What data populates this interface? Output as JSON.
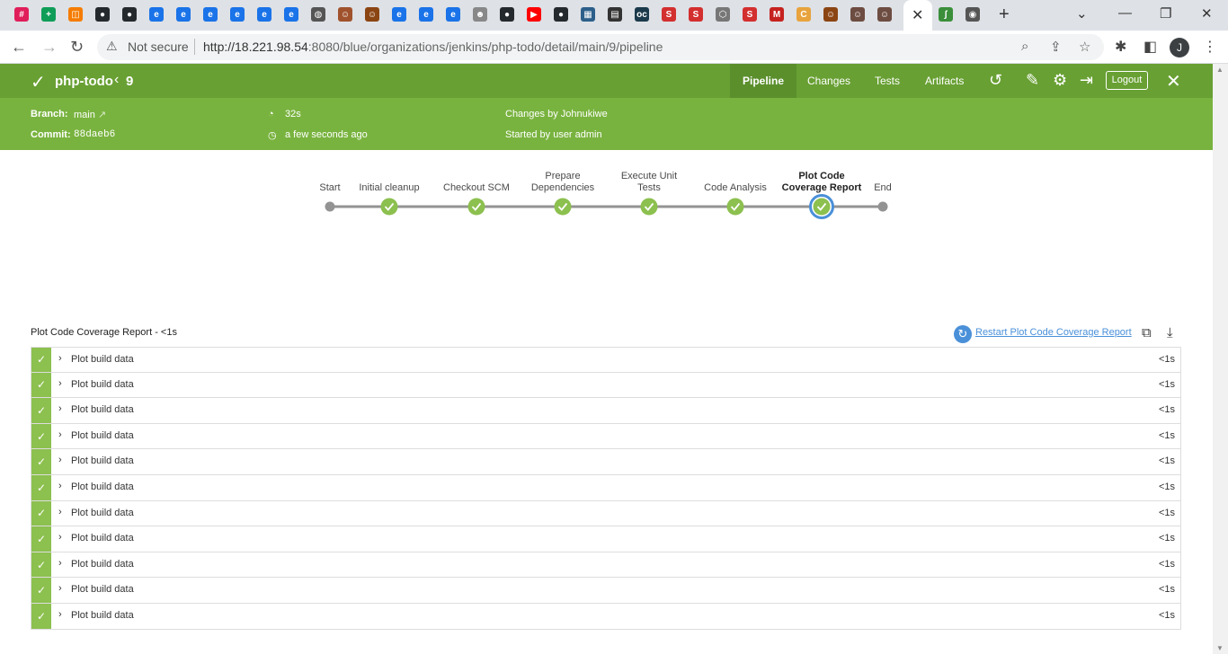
{
  "browser": {
    "tab_icons": [
      {
        "icon": "slack-icon",
        "glyph": "#",
        "color": "#e01e5a"
      },
      {
        "icon": "sheets-icon",
        "glyph": "+",
        "color": "#0f9d58"
      },
      {
        "icon": "app-icon",
        "glyph": "◫",
        "color": "#f57c00"
      },
      {
        "icon": "github-icon",
        "glyph": "●",
        "color": "#24292e"
      },
      {
        "icon": "github-icon",
        "glyph": "●",
        "color": "#24292e"
      },
      {
        "icon": "blue-app-icon",
        "glyph": "e",
        "color": "#1a73e8"
      },
      {
        "icon": "blue-app-icon",
        "glyph": "e",
        "color": "#1a73e8"
      },
      {
        "icon": "blue-app-icon",
        "glyph": "e",
        "color": "#1a73e8"
      },
      {
        "icon": "blue-app-icon",
        "glyph": "e",
        "color": "#1a73e8"
      },
      {
        "icon": "blue-app-icon",
        "glyph": "e",
        "color": "#1a73e8"
      },
      {
        "icon": "blue-app-icon",
        "glyph": "e",
        "color": "#1a73e8"
      },
      {
        "icon": "globe-icon",
        "glyph": "◍",
        "color": "#555555"
      },
      {
        "icon": "avatar-tab-icon",
        "glyph": "☺",
        "color": "#a0522d"
      },
      {
        "icon": "avatar-tab-icon",
        "glyph": "☺",
        "color": "#8b4513"
      },
      {
        "icon": "blue-app-icon",
        "glyph": "e",
        "color": "#1a73e8"
      },
      {
        "icon": "blue-app-icon",
        "glyph": "e",
        "color": "#1a73e8"
      },
      {
        "icon": "blue-app-icon",
        "glyph": "e",
        "color": "#1a73e8"
      },
      {
        "icon": "jenkins-icon",
        "glyph": "☻",
        "color": "#888888"
      },
      {
        "icon": "github-icon",
        "glyph": "●",
        "color": "#24292e"
      },
      {
        "icon": "youtube-icon",
        "glyph": "▶",
        "color": "#ff0000"
      },
      {
        "icon": "github-icon",
        "glyph": "●",
        "color": "#24292e"
      },
      {
        "icon": "grid-icon",
        "glyph": "▦",
        "color": "#2c5f8a"
      },
      {
        "icon": "bbc-icon",
        "glyph": "▤",
        "color": "#333333"
      },
      {
        "icon": "oc-icon",
        "glyph": "oc",
        "color": "#1b3a4b"
      },
      {
        "icon": "s-app-icon",
        "glyph": "S",
        "color": "#d32f2f"
      },
      {
        "icon": "s-app-icon",
        "glyph": "S",
        "color": "#d32f2f"
      },
      {
        "icon": "hex-icon",
        "glyph": "⬡",
        "color": "#777777"
      },
      {
        "icon": "s-app-icon",
        "glyph": "S",
        "color": "#d32f2f"
      },
      {
        "icon": "gmail-icon",
        "glyph": "M",
        "color": "#c5221f"
      },
      {
        "icon": "c-app-icon",
        "glyph": "C",
        "color": "#e8a33d"
      },
      {
        "icon": "avatar-tab-icon",
        "glyph": "☺",
        "color": "#8b4513"
      },
      {
        "icon": "avatar-tab-icon",
        "glyph": "☺",
        "color": "#6d4c41"
      },
      {
        "icon": "avatar-tab-icon",
        "glyph": "☺",
        "color": "#6d4c41"
      }
    ],
    "tab_icons_after_active": [
      {
        "icon": "snake-icon",
        "glyph": "ʃ",
        "color": "#3b8f3b"
      },
      {
        "icon": "chrome-icon",
        "glyph": "◉",
        "color": "#555555"
      }
    ],
    "not_secure_label": "Not secure",
    "url_host": "http://18.221.98.54",
    "url_rest": ":8080/blue/organizations/jenkins/php-todo/detail/main/9/pipeline",
    "profile_initial": "J"
  },
  "header": {
    "job_name": "php-todo",
    "run_number": "9",
    "tabs": [
      "Pipeline",
      "Changes",
      "Tests",
      "Artifacts"
    ],
    "logout_label": "Logout"
  },
  "summary": {
    "branch_label": "Branch:",
    "branch_value": "main",
    "commit_label": "Commit:",
    "commit_value": "88daeb6",
    "duration": "32s",
    "finished": "a few seconds ago",
    "changes_by": "Changes by Johnukiwe",
    "started_by": "Started by user admin"
  },
  "pipeline": {
    "stages": [
      {
        "label": [
          "Start"
        ],
        "status": "start"
      },
      {
        "label": [
          "Initial cleanup"
        ],
        "status": "success"
      },
      {
        "label": [
          "Checkout SCM"
        ],
        "status": "success"
      },
      {
        "label": [
          "Prepare",
          "Dependencies"
        ],
        "status": "success"
      },
      {
        "label": [
          "Execute Unit",
          "Tests"
        ],
        "status": "success"
      },
      {
        "label": [
          "Code Analysis"
        ],
        "status": "success"
      },
      {
        "label": [
          "Plot Code",
          "Coverage Report"
        ],
        "status": "success",
        "selected": true
      },
      {
        "label": [
          "End"
        ],
        "status": "end"
      }
    ]
  },
  "log": {
    "title": "Plot Code Coverage Report - <1s",
    "restart_label": "Restart Plot Code Coverage Report",
    "steps": [
      {
        "name": "Plot build data",
        "duration": "<1s"
      },
      {
        "name": "Plot build data",
        "duration": "<1s"
      },
      {
        "name": "Plot build data",
        "duration": "<1s"
      },
      {
        "name": "Plot build data",
        "duration": "<1s"
      },
      {
        "name": "Plot build data",
        "duration": "<1s"
      },
      {
        "name": "Plot build data",
        "duration": "<1s"
      },
      {
        "name": "Plot build data",
        "duration": "<1s"
      },
      {
        "name": "Plot build data",
        "duration": "<1s"
      },
      {
        "name": "Plot build data",
        "duration": "<1s"
      },
      {
        "name": "Plot build data",
        "duration": "<1s"
      },
      {
        "name": "Plot build data",
        "duration": "<1s"
      }
    ]
  },
  "colors": {
    "header_green": "#68a033",
    "subheader_green": "#79b33f",
    "success_green": "#8cc04f",
    "selected_ring": "#4a90d9"
  }
}
